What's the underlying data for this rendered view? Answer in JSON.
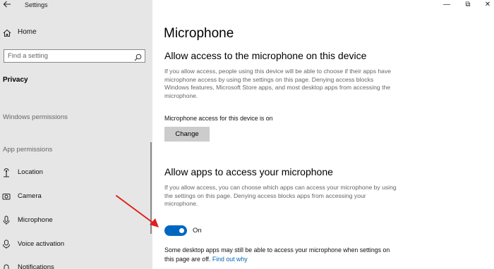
{
  "window": {
    "title": "Settings",
    "controls": {
      "minimize": "—",
      "maximize": "⧉",
      "close": "✕"
    }
  },
  "sidebar": {
    "home_label": "Home",
    "search_placeholder": "Find a setting",
    "current_section": "Privacy",
    "windows_permissions_header": "Windows permissions",
    "app_permissions_header": "App permissions",
    "items": [
      {
        "label": "Location",
        "icon": "location-icon"
      },
      {
        "label": "Camera",
        "icon": "camera-icon"
      },
      {
        "label": "Microphone",
        "icon": "microphone-icon"
      },
      {
        "label": "Voice activation",
        "icon": "voice-activation-icon"
      },
      {
        "label": "Notifications",
        "icon": "notifications-icon"
      }
    ]
  },
  "main": {
    "page_title": "Microphone",
    "device_access": {
      "heading": "Allow access to the microphone on this device",
      "description": "If you allow access, people using this device will be able to choose if their apps have microphone access by using the settings on this page. Denying access blocks Windows features, Microsoft Store apps, and most desktop apps from accessing the microphone.",
      "status": "Microphone access for this device is on",
      "button_label": "Change"
    },
    "app_access": {
      "heading": "Allow apps to access your microphone",
      "description": "If you allow access, you can choose which apps can access your microphone by using the settings on this page. Denying access blocks apps from accessing your microphone.",
      "toggle_state": "On",
      "toggle_on": true,
      "note": "Some desktop apps may still be able to access your microphone when settings on this page are off.",
      "note_link": "Find out why"
    }
  },
  "colors": {
    "sidebar_bg": "#e6e6e6",
    "accent": "#0067c0",
    "link": "#0066b4",
    "annotation_arrow": "#e0201e"
  }
}
